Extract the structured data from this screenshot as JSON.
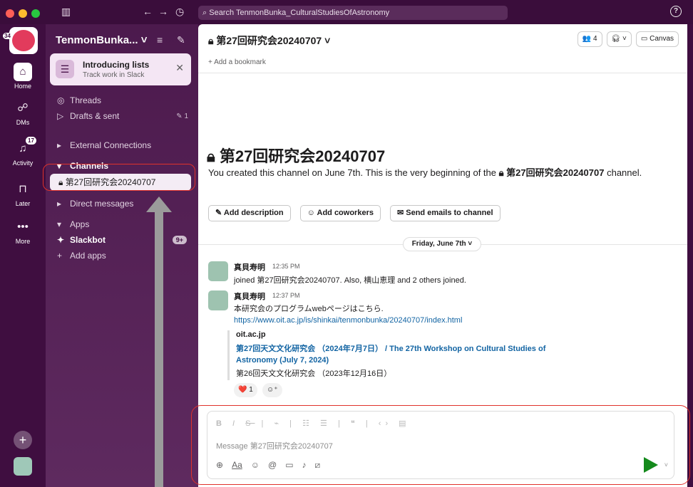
{
  "titlebar": {
    "search_placeholder": "Search TenmonBunka_CulturalStudiesOfAstronomy"
  },
  "rail": {
    "ws_badge": "34",
    "home": "Home",
    "dms": "DMs",
    "activity": "Activity",
    "activity_badge": "17",
    "later": "Later",
    "more": "More"
  },
  "sidebar": {
    "workspace": "TenmonBunka...",
    "lists_title": "Introducing lists",
    "lists_sub": "Track work in Slack",
    "threads": "Threads",
    "drafts": "Drafts & sent",
    "drafts_count": "1",
    "external": "External Connections",
    "channels": "Channels",
    "channel_selected": "第27回研究会20240707",
    "direct_messages": "Direct messages",
    "apps": "Apps",
    "slackbot": "Slackbot",
    "slackbot_badge": "9+",
    "add_apps": "Add apps"
  },
  "header": {
    "channel": "第27回研究会20240707",
    "members": "4",
    "canvas": "Canvas",
    "bookmark": "+ Add a bookmark"
  },
  "intro": {
    "title": "第27回研究会20240707",
    "text": "You created this channel on June 7th. This is the very beginning of the",
    "text_channel": "第27回研究会20240707",
    "text_end": "channel.",
    "btn_description": "Add description",
    "btn_coworkers": "Add coworkers",
    "btn_emails": "Send emails to channel"
  },
  "date_divider": "Friday, June 7th",
  "messages": [
    {
      "name": "真貝寿明",
      "time": "12:35 PM",
      "text": "joined 第27回研究会20240707. Also, 横山恵理 and 2 others joined."
    },
    {
      "name": "真貝寿明",
      "time": "12:37 PM",
      "text": "本研究会のプログラムwebページはこちら.",
      "link": "https://www.oit.ac.jp/is/shinkai/tenmonbunka/20240707/index.html"
    }
  ],
  "unfurl": {
    "site": "oit.ac.jp",
    "title": "第27回天文文化研究会 （2024年7月7日） / The 27th Workshop on Cultural Studies of Astronomy (July 7, 2024)",
    "desc": "第26回天文文化研究会 （2023年12月16日）"
  },
  "reaction": {
    "emoji": "❤️",
    "count": "1"
  },
  "composer": {
    "placeholder": "Message 第27回研究会20240707"
  }
}
